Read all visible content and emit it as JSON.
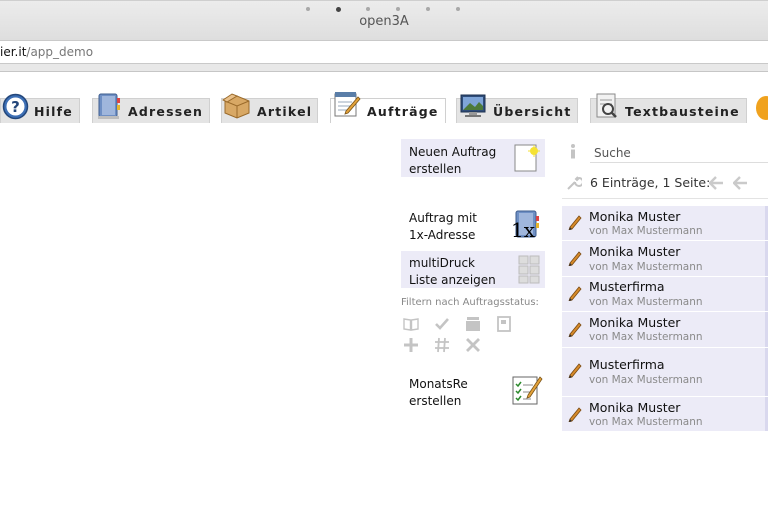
{
  "window": {
    "title": "open3A",
    "url_host": "ier.it",
    "url_path": "/app_demo"
  },
  "tabs": [
    {
      "label": "Hilfe",
      "icon": "help-icon"
    },
    {
      "label": "Adressen",
      "icon": "address-book-icon"
    },
    {
      "label": "Artikel",
      "icon": "package-icon"
    },
    {
      "label": "Aufträge",
      "icon": "notepad-icon",
      "active": true
    },
    {
      "label": "Übersicht",
      "icon": "monitor-icon"
    },
    {
      "label": "Textbausteine",
      "icon": "text-module-icon"
    }
  ],
  "menu": {
    "new_order": {
      "line1": "Neuen Auftrag",
      "line2": "erstellen"
    },
    "order_address": {
      "line1": "Auftrag mit",
      "line2": "1x-Adresse",
      "icon_text": "1x"
    },
    "multidruck": {
      "line1": "multiDruck",
      "line2": "Liste anzeigen"
    },
    "filter_label": "Filtern nach Auftragsstatus:",
    "monthly": {
      "line1": "MonatsRe",
      "line2": "erstellen"
    }
  },
  "list": {
    "search_placeholder": "Suche",
    "pager_text": "6 Einträge, 1 Seite:",
    "rows": [
      {
        "name": "Monika Muster",
        "sub": "von Max Mustermann"
      },
      {
        "name": "Monika Muster",
        "sub": "von Max Mustermann"
      },
      {
        "name": "Musterfirma",
        "sub": "von Max Mustermann"
      },
      {
        "name": "Monika Muster",
        "sub": "von Max Mustermann"
      },
      {
        "name": "Musterfirma",
        "sub": "von Max Mustermann"
      },
      {
        "name": "Monika Muster",
        "sub": "von Max Mustermann"
      }
    ]
  },
  "colors": {
    "accent_row": "#ecebf7",
    "icon_grey": "#c4c4c4",
    "pencil": "#c97a1a"
  }
}
